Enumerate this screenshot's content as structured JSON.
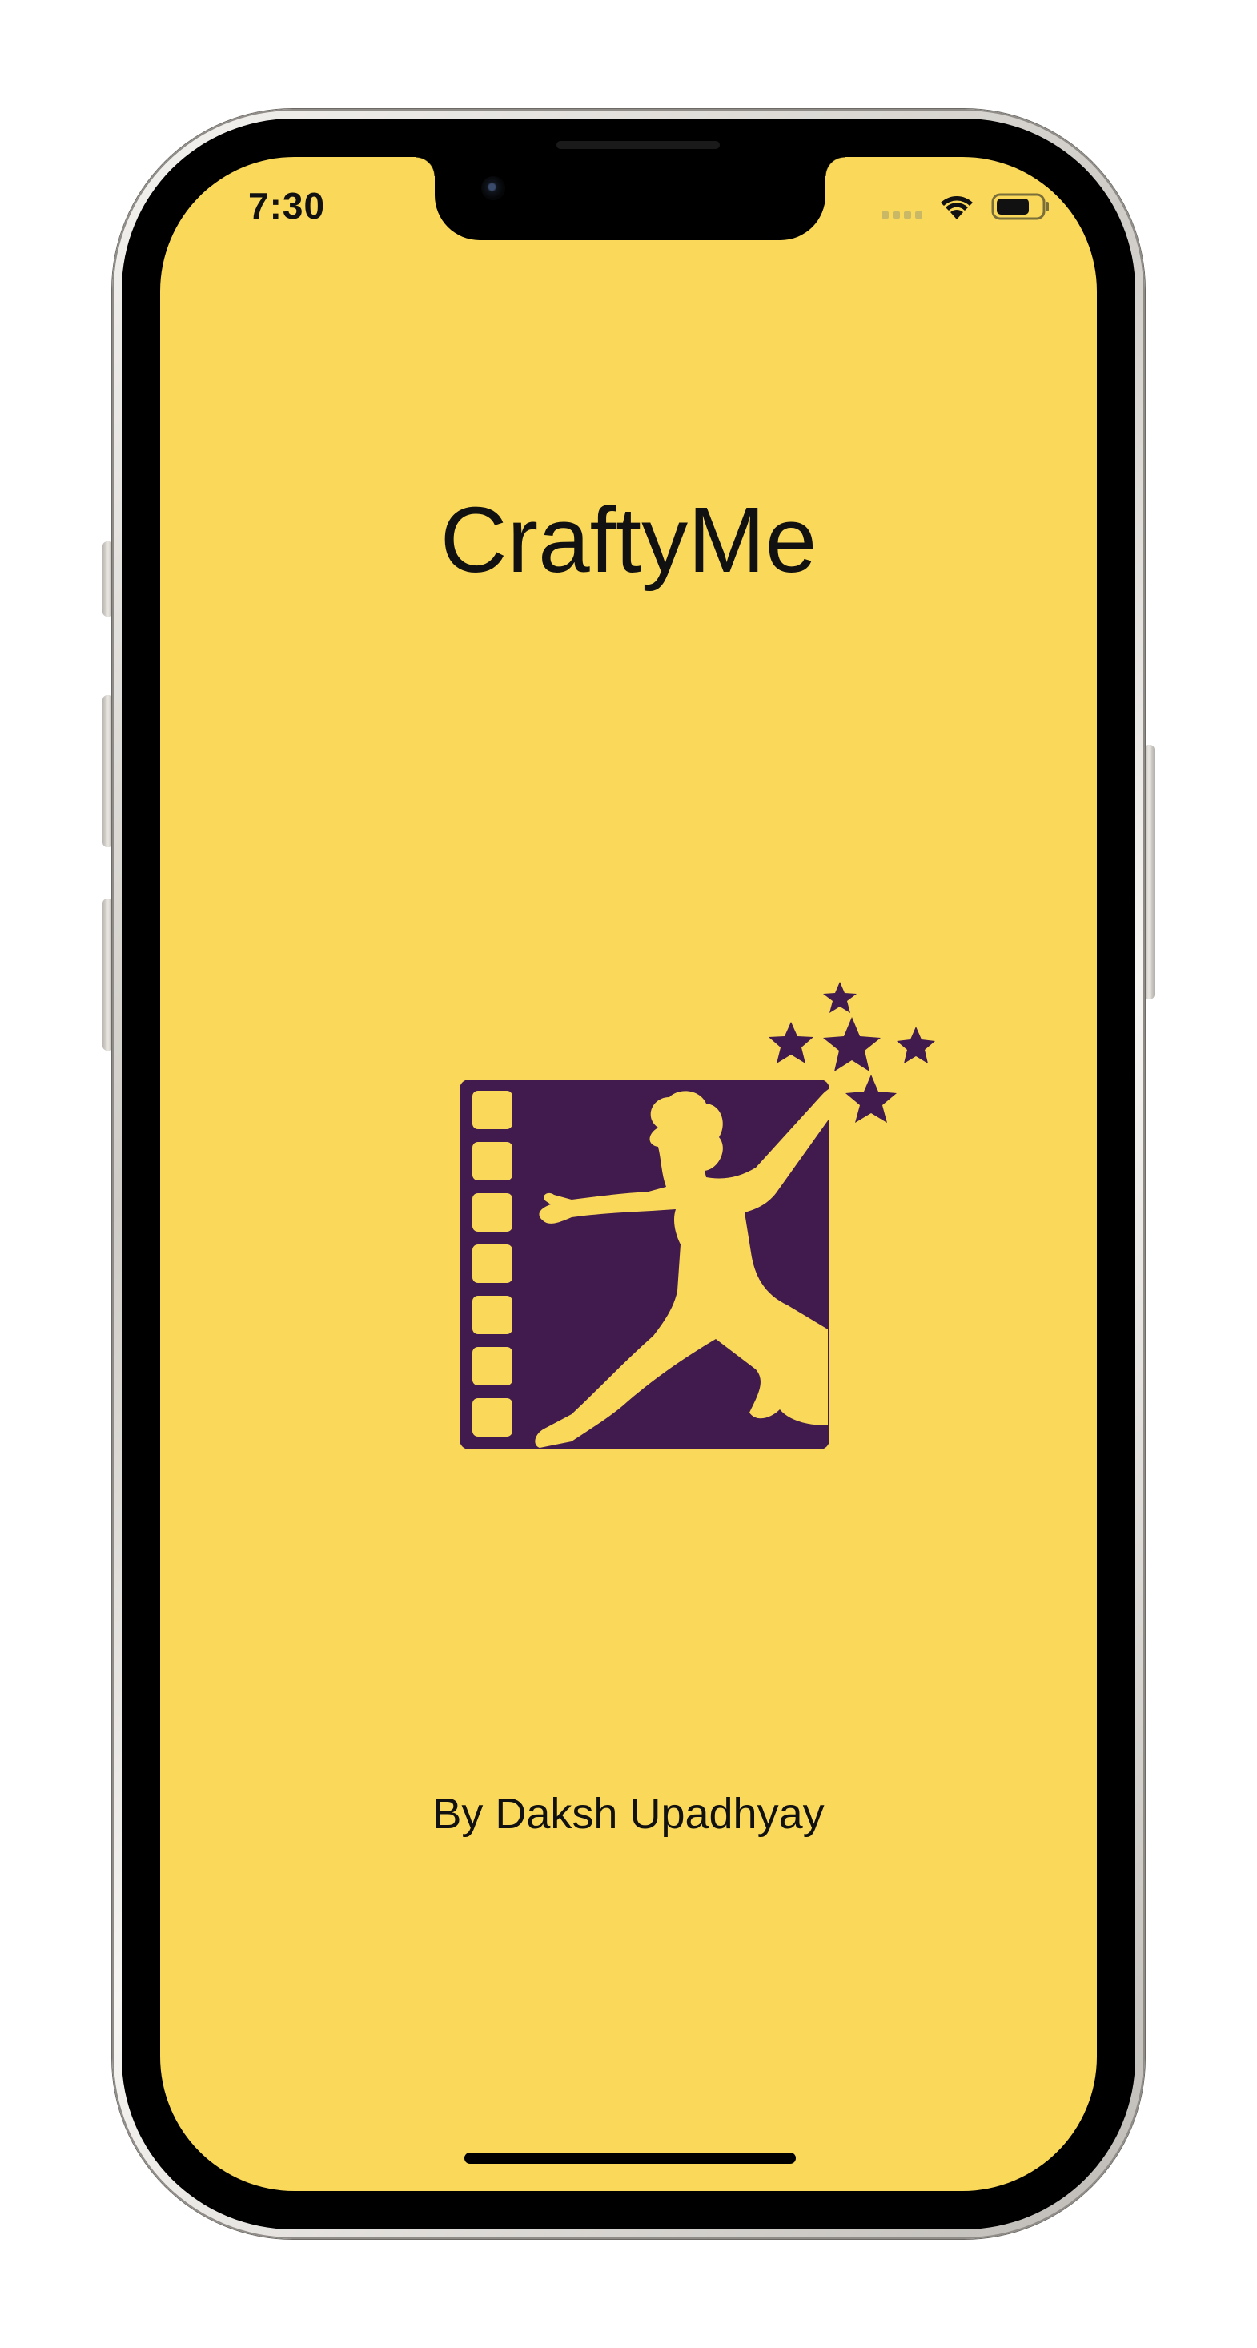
{
  "status_bar": {
    "time": "7:30",
    "icons": [
      "cellular-signal-icon",
      "wifi-icon",
      "battery-icon"
    ]
  },
  "app": {
    "title": "CraftyMe",
    "logo_icon": "film-strip-jumping-child-stars-logo",
    "author": "By Daksh Upadhyay"
  },
  "colors": {
    "background": "#fad95a",
    "logo": "#411a4e",
    "text": "#111111"
  }
}
